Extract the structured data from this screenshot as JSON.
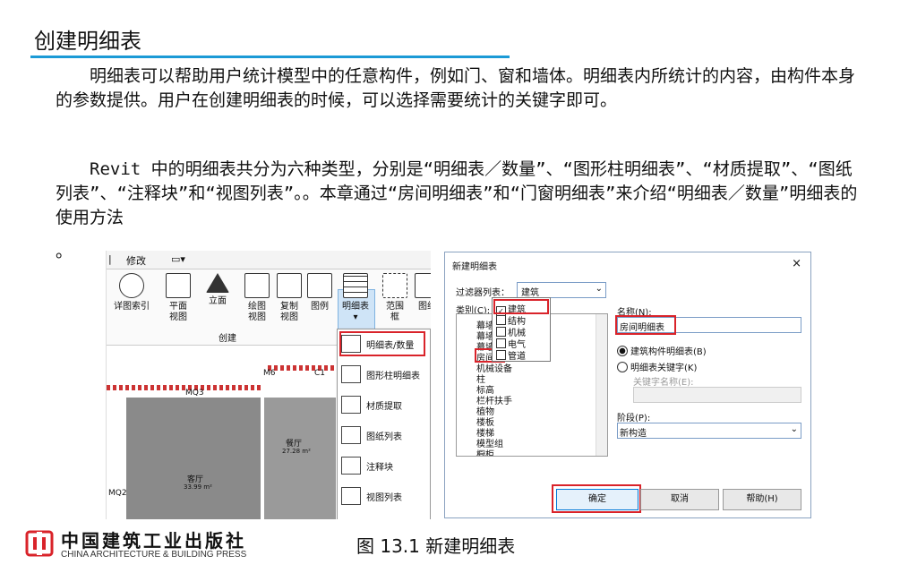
{
  "heading": "创建明细表",
  "paragraph1": "　　明细表可以帮助用户统计模型中的任意构件，例如门、窗和墙体。明细表内所统计的内容，由构件本身的参数提供。用户在创建明细表的时候，可以选择需要统计的关键字即可。",
  "paragraph2": "　　Revit 中的明细表共分为六种类型，分别是“明细表／数量”、“图形柱明细表”、“材质提取”、“图纸列表”、“注释块”和“视图列表”。。本章通过“房间明细表”和“门窗明细表”来介绍“明细表／数量”明细表的使用方法",
  "paragraph3": "。",
  "ribbon": {
    "tab_modify": "修改",
    "tab_dropdown": "▭▾",
    "tools": [
      "详图索引",
      "平面视图",
      "立面",
      "绘图视图",
      "复制视图",
      "图例",
      "明细表",
      "范围框",
      "图纸"
    ],
    "tools_line1": [
      "详图索引",
      "平面",
      "立面",
      "绘图",
      "复制",
      "图例",
      "明细表",
      "范围",
      "图纸"
    ],
    "tools_line2": [
      "",
      "视图",
      "",
      "视图",
      "视图",
      "",
      "",
      "框",
      ""
    ],
    "group_label": "创建",
    "dropdown_items": [
      "明细表/数量",
      "图形柱明细表",
      "材质提取",
      "图纸列表",
      "注释块",
      "视图列表"
    ],
    "plan_labels": {
      "mq3": "MQ3",
      "mq2": "MQ2",
      "m6": "M6",
      "c1": "C1",
      "room1": "餐厅",
      "area1": "27.28 m²",
      "room2": "客厅",
      "area2": "33.99 m²"
    }
  },
  "dialog": {
    "title": "新建明细表",
    "close": "×",
    "filter_label": "过滤器列表：",
    "filter_value": "建筑",
    "category_label": "类别(C):",
    "filter_options": [
      {
        "label": "建筑",
        "checked": true
      },
      {
        "label": "结构",
        "checked": false
      },
      {
        "label": "机械",
        "checked": false
      },
      {
        "label": "电气",
        "checked": false
      },
      {
        "label": "管道",
        "checked": false
      }
    ],
    "categories": [
      "幕墙嵌板",
      "幕墙竖梃",
      "幕墙系统",
      "房间",
      "机械设备",
      "柱",
      "标高",
      "栏杆扶手",
      "植物",
      "楼板",
      "楼梯",
      "模型组",
      "橱柜"
    ],
    "name_label": "名称(N):",
    "name_value": "房间明细表",
    "radio1": "建筑构件明细表(B)",
    "radio2": "明细表关键字(K)",
    "key_name_label": "关键字名称(E):",
    "phase_label": "阶段(P):",
    "phase_value": "新构造",
    "ok": "确定",
    "cancel": "取消",
    "help": "帮助(H)"
  },
  "footer": {
    "publisher_cn": "中国建筑工业出版社",
    "publisher_en": "CHINA ARCHITECTURE & BUILDING PRESS",
    "caption": "图 13.1  新建明细表"
  },
  "colors": {
    "accent_rule": "#1b9ad6",
    "highlight_red": "#d9232a",
    "logo_red": "#d9232a"
  }
}
